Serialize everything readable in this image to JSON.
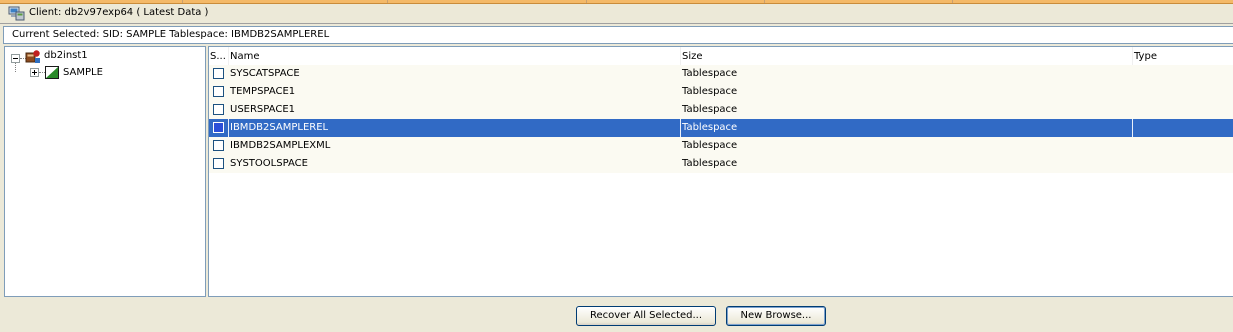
{
  "window": {
    "title": "Client: db2v97exp64 ( Latest Data )"
  },
  "current_selected": {
    "text": "Current Selected: SID: SAMPLE  Tablespace: IBMDB2SAMPLEREL"
  },
  "tree": {
    "root": {
      "label": "db2inst1",
      "icon": "db2-instance-icon",
      "expanded": true
    },
    "children": [
      {
        "label": "SAMPLE",
        "icon": "database-icon",
        "expanded": false
      }
    ]
  },
  "grid": {
    "columns": [
      "S...",
      "Name",
      "Size",
      "Type"
    ],
    "rows": [
      {
        "name": "SYSCATSPACE",
        "size": "Tablespace",
        "type": "",
        "checked": false,
        "selected": false
      },
      {
        "name": "TEMPSPACE1",
        "size": "Tablespace",
        "type": "",
        "checked": false,
        "selected": false
      },
      {
        "name": "USERSPACE1",
        "size": "Tablespace",
        "type": "",
        "checked": false,
        "selected": false
      },
      {
        "name": "IBMDB2SAMPLEREL",
        "size": "Tablespace",
        "type": "",
        "checked": true,
        "selected": true
      },
      {
        "name": "IBMDB2SAMPLEXML",
        "size": "Tablespace",
        "type": "",
        "checked": false,
        "selected": false
      },
      {
        "name": "SYSTOOLSPACE",
        "size": "Tablespace",
        "type": "",
        "checked": false,
        "selected": false
      }
    ]
  },
  "buttons": {
    "recover_all": "Recover All Selected...",
    "new_browse": "New Browse..."
  },
  "colors": {
    "selection": "#316ac5",
    "panel_border": "#7f9db9",
    "background": "#ece9d8"
  }
}
